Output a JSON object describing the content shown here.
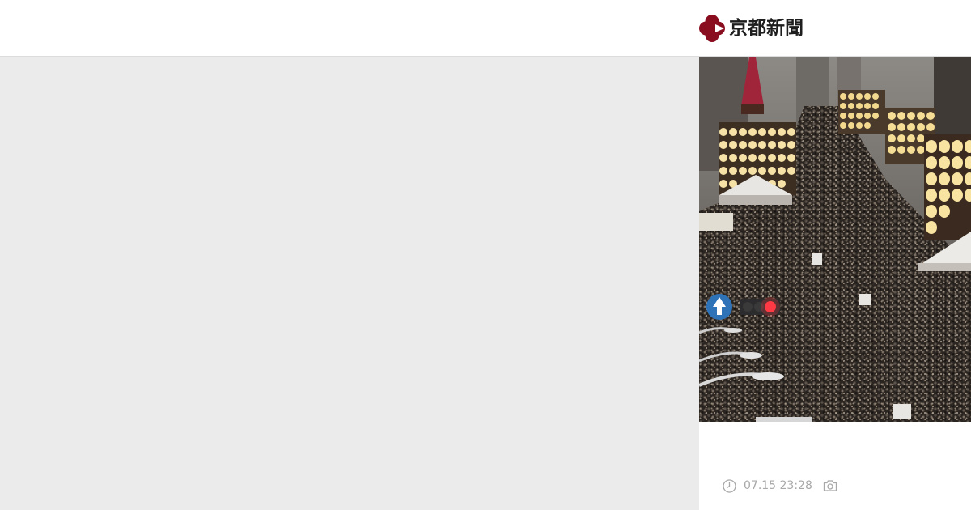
{
  "header": {
    "logo_text": "京都新聞",
    "logo_icon": "kyoto-shimbun-mark-icon",
    "brand_color": "#8a0c1f"
  },
  "article": {
    "photo_alt": "",
    "timestamp": "07.15 23:28",
    "timestamp_icon": "clock-icon",
    "photo_icon": "camera-icon"
  },
  "colors": {
    "left_panel_bg": "#ebebeb",
    "meta_text": "#a8a8a8",
    "header_border": "#dcdcdc"
  }
}
